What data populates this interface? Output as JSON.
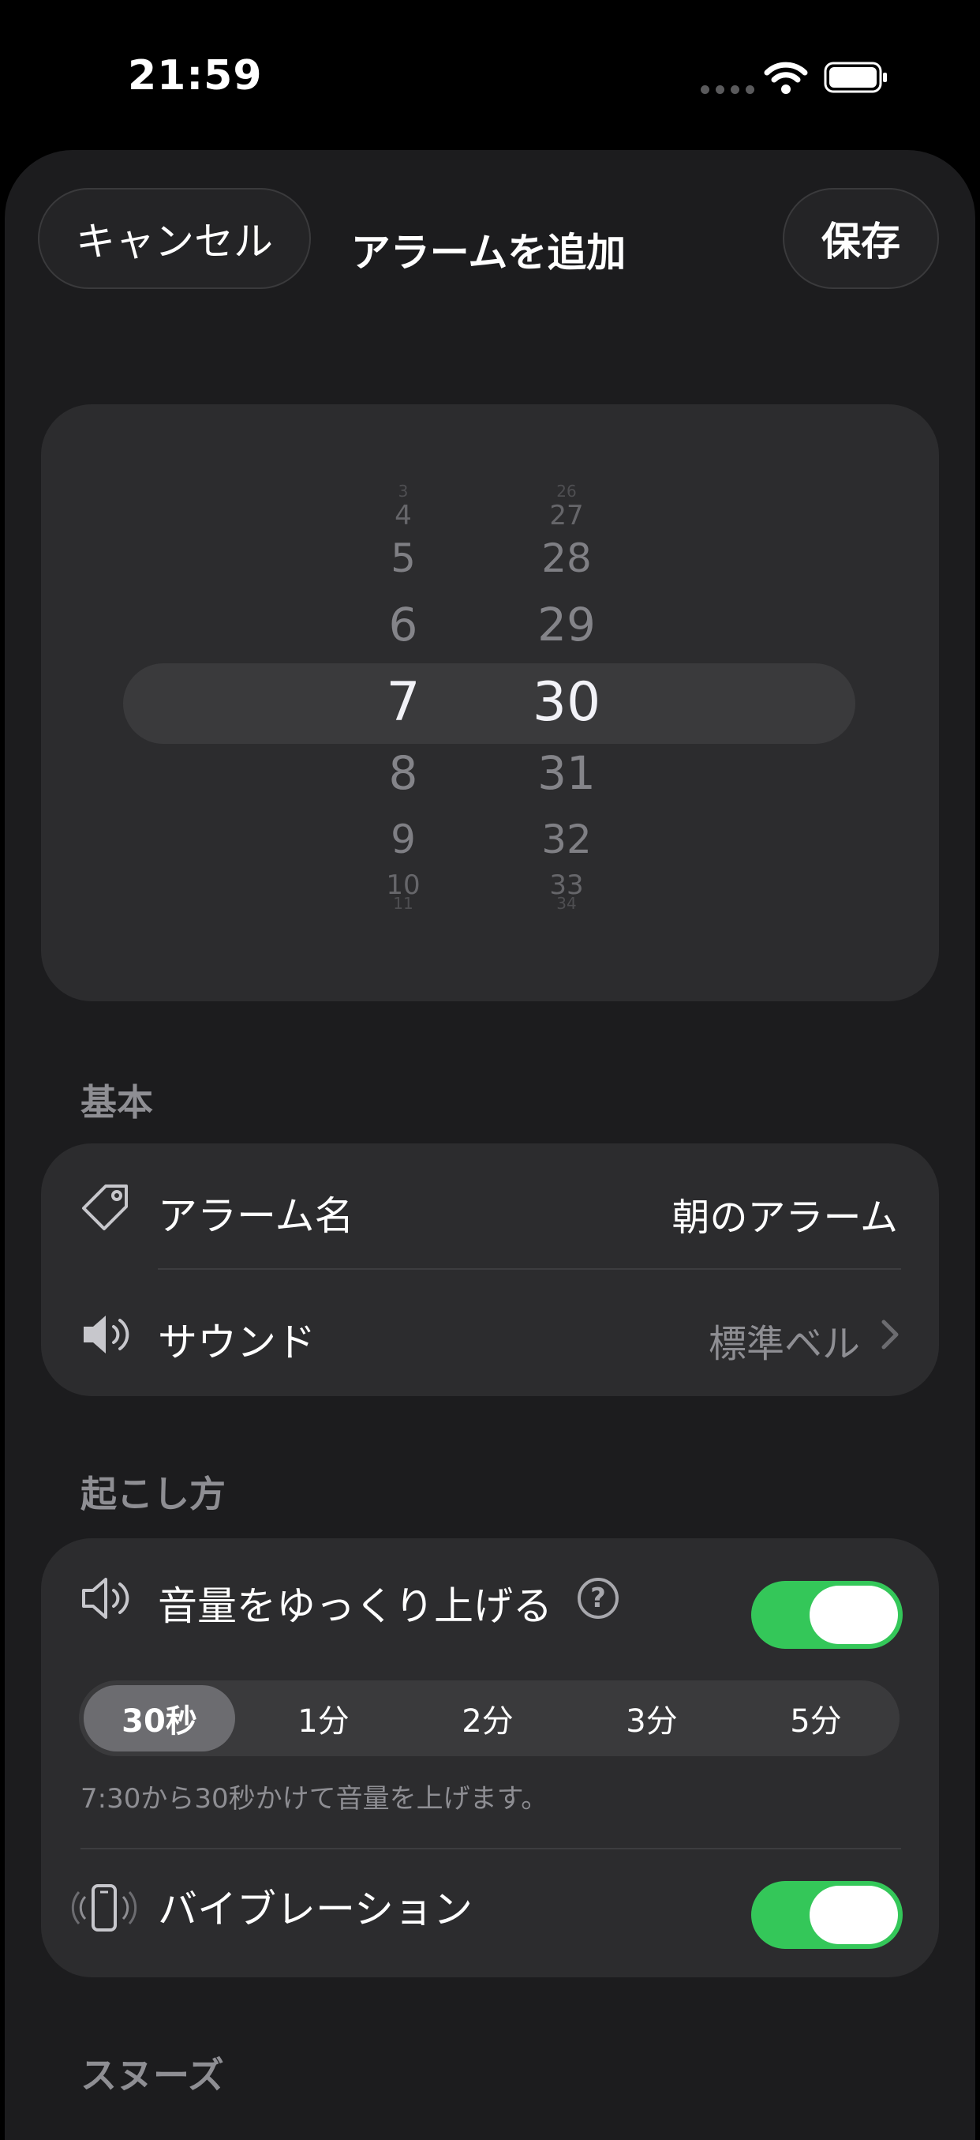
{
  "status_bar": {
    "time": "21:59"
  },
  "header": {
    "cancel_label": "キャンセル",
    "title": "アラームを追加",
    "save_label": "保存"
  },
  "picker": {
    "hours": [
      "3",
      "4",
      "5",
      "6",
      "7",
      "8",
      "9",
      "10",
      "11"
    ],
    "minutes": [
      "26",
      "27",
      "28",
      "29",
      "30",
      "31",
      "32",
      "33",
      "34"
    ],
    "selected_hour": "7",
    "selected_minute": "30"
  },
  "basic": {
    "section_title": "基本",
    "alarm_name_label": "アラーム名",
    "alarm_name_value": "朝のアラーム",
    "sound_label": "サウンド",
    "sound_value": "標準ベル"
  },
  "wake": {
    "section_title": "起こし方",
    "gradual_volume_label": "音量をゆっくり上げる",
    "gradual_volume_on": true,
    "durations": [
      "30秒",
      "1分",
      "2分",
      "3分",
      "5分"
    ],
    "selected_duration": "30秒",
    "note": "7:30から30秒かけて音量を上げます。",
    "vibration_label": "バイブレーション",
    "vibration_on": true
  },
  "snooze": {
    "section_title": "スヌーズ"
  },
  "colors": {
    "accent_green": "#34c759",
    "sheet_bg": "#1c1c1e",
    "card_bg": "#2c2c2e"
  },
  "icons": [
    "wifi-icon",
    "battery-icon",
    "tag-icon",
    "speaker-icon",
    "speaker-low-icon",
    "help-icon",
    "phone-vibrate-icon",
    "chevron-right-icon"
  ]
}
